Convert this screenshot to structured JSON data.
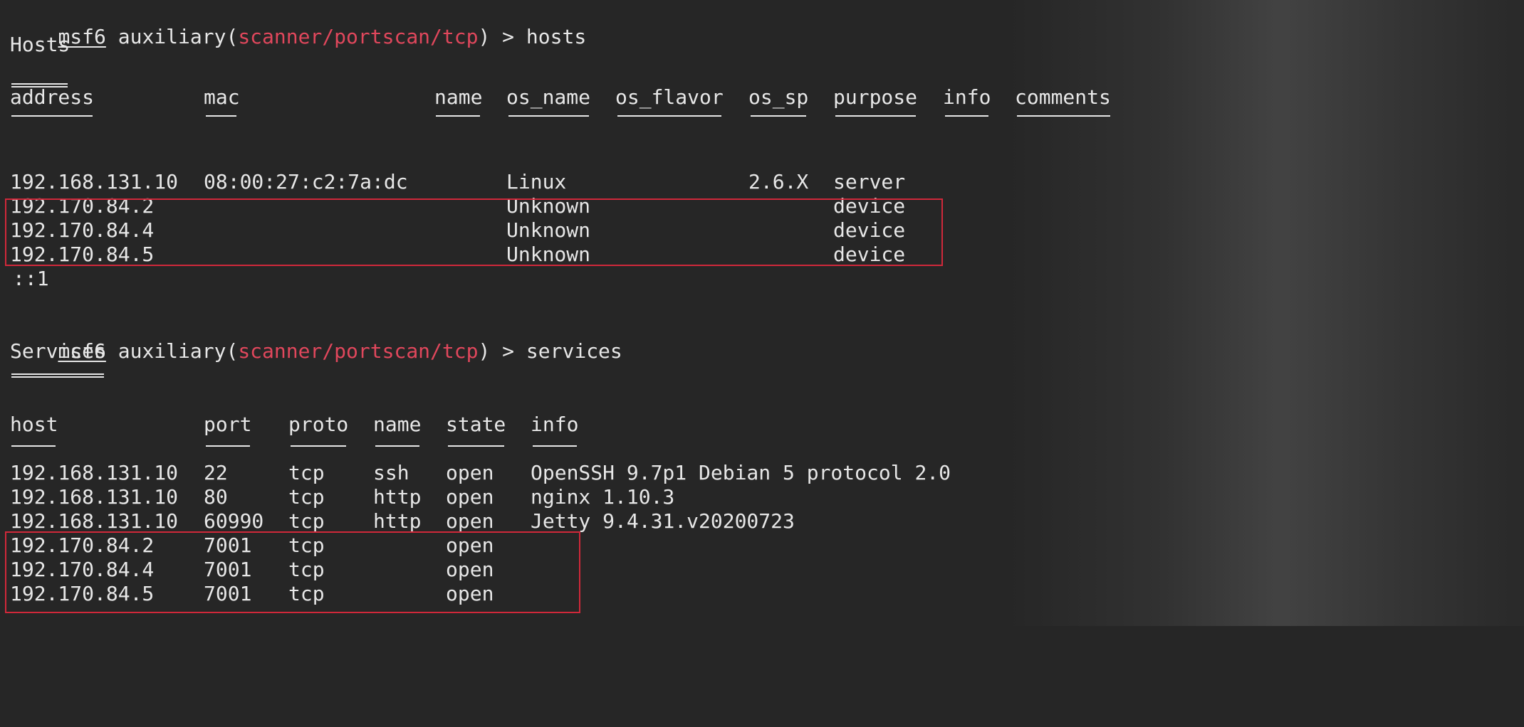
{
  "prompt": {
    "user": "msf6",
    "module_prefix": " auxiliary(",
    "module": "scanner/portscan/tcp",
    "module_suffix": ") > "
  },
  "commands": {
    "hosts": "hosts",
    "services": "services"
  },
  "hosts_table": {
    "title": "Hosts",
    "columns": [
      "address",
      "mac",
      "name",
      "os_name",
      "os_flavor",
      "os_sp",
      "purpose",
      "info",
      "comments"
    ],
    "rows": [
      {
        "address": "192.168.131.10",
        "mac": "08:00:27:c2:7a:dc",
        "name": "",
        "os_name": "Linux",
        "os_flavor": "",
        "os_sp": "2.6.X",
        "purpose": "server",
        "info": "",
        "comments": ""
      },
      {
        "address": "192.170.84.2",
        "mac": "",
        "name": "",
        "os_name": "Unknown",
        "os_flavor": "",
        "os_sp": "",
        "purpose": "device",
        "info": "",
        "comments": ""
      },
      {
        "address": "192.170.84.4",
        "mac": "",
        "name": "",
        "os_name": "Unknown",
        "os_flavor": "",
        "os_sp": "",
        "purpose": "device",
        "info": "",
        "comments": ""
      },
      {
        "address": "192.170.84.5",
        "mac": "",
        "name": "",
        "os_name": "Unknown",
        "os_flavor": "",
        "os_sp": "",
        "purpose": "device",
        "info": "",
        "comments": ""
      },
      {
        "address": "::1",
        "mac": "",
        "name": "",
        "os_name": "",
        "os_flavor": "",
        "os_sp": "",
        "purpose": "",
        "info": "",
        "comments": ""
      }
    ]
  },
  "services_table": {
    "title": "Services",
    "columns": [
      "host",
      "port",
      "proto",
      "name",
      "state",
      "info"
    ],
    "rows": [
      {
        "host": "192.168.131.10",
        "port": "22",
        "proto": "tcp",
        "name": "ssh",
        "state": "open",
        "info": "OpenSSH 9.7p1 Debian 5 protocol 2.0"
      },
      {
        "host": "192.168.131.10",
        "port": "80",
        "proto": "tcp",
        "name": "http",
        "state": "open",
        "info": "nginx 1.10.3"
      },
      {
        "host": "192.168.131.10",
        "port": "60990",
        "proto": "tcp",
        "name": "http",
        "state": "open",
        "info": "Jetty 9.4.31.v20200723"
      },
      {
        "host": "192.170.84.2",
        "port": "7001",
        "proto": "tcp",
        "name": "",
        "state": "open",
        "info": ""
      },
      {
        "host": "192.170.84.4",
        "port": "7001",
        "proto": "tcp",
        "name": "",
        "state": "open",
        "info": ""
      },
      {
        "host": "192.170.84.5",
        "port": "7001",
        "proto": "tcp",
        "name": "",
        "state": "open",
        "info": ""
      }
    ]
  },
  "colors": {
    "background": "#262626",
    "text": "#e7e7e7",
    "module": "#e0475c",
    "highlight_box": "#d0283a"
  }
}
